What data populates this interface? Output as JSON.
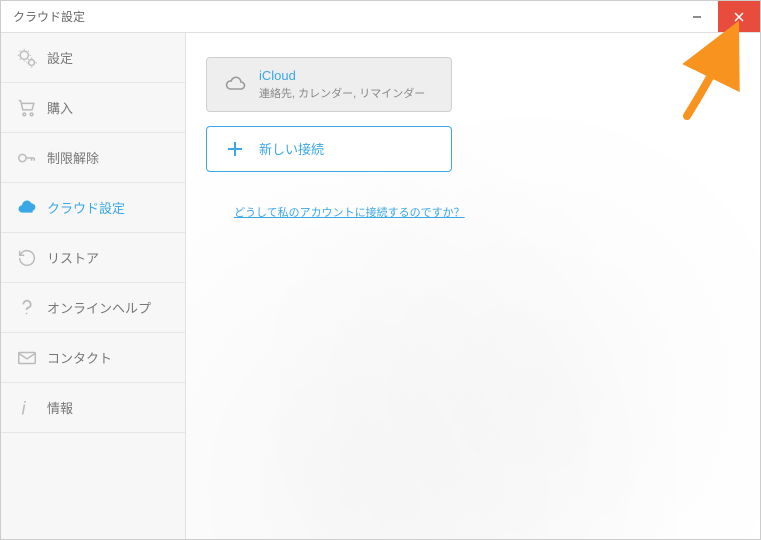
{
  "window": {
    "title": "クラウド設定"
  },
  "sidebar": {
    "items": [
      {
        "label": "設定"
      },
      {
        "label": "購入"
      },
      {
        "label": "制限解除"
      },
      {
        "label": "クラウド設定"
      },
      {
        "label": "リストア"
      },
      {
        "label": "オンラインヘルプ"
      },
      {
        "label": "コンタクト"
      },
      {
        "label": "情報"
      }
    ]
  },
  "content": {
    "icloud": {
      "title": "iCloud",
      "subtitle": "連絡先, カレンダー, リマインダー"
    },
    "new_connection_label": "新しい接続",
    "help_link": "どうして私のアカウントに接続するのですか？"
  }
}
